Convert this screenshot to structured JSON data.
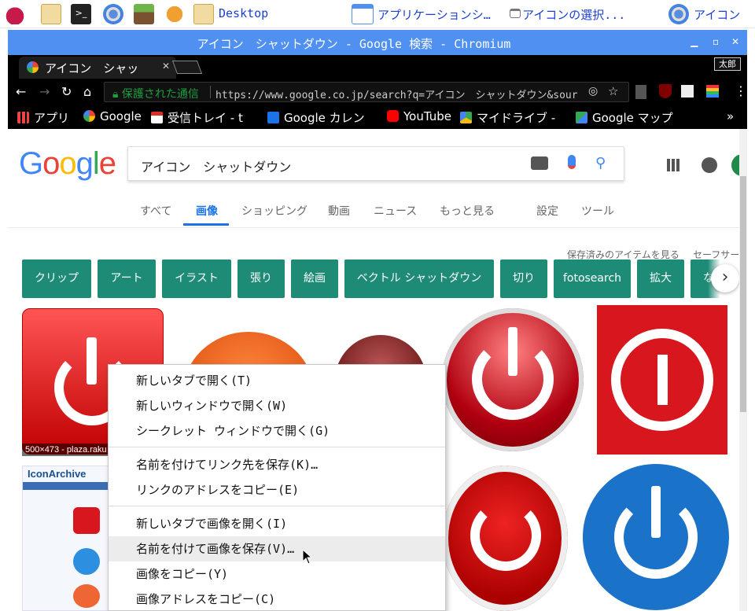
{
  "panel": {
    "desktop_label": "Desktop",
    "task1": "アプリケーションシ…",
    "task2": "アイコンの選択...",
    "task3": "アイコン"
  },
  "window": {
    "title": "アイコン　シャットダウン - Google 検索 - Chromium",
    "tab_title": "アイコン　シャッ",
    "profile_name": "太郎"
  },
  "toolbar": {
    "secure_label": "保護された通信",
    "url": "https://www.google.co.jp/search?q=アイコン　シャットダウン&sourc…"
  },
  "bookmarks": {
    "apps": "アプリ",
    "google": "Google",
    "inbox": "受信トレイ - t",
    "calendar": "Google カレン",
    "youtube": "YouTube",
    "drive": "マイドライブ -",
    "maps": "Google マップ",
    "overflow": "»"
  },
  "search": {
    "query": "アイコン　シャットダウン",
    "tabs": [
      "すべて",
      "画像",
      "ショッピング",
      "動画",
      "ニュース",
      "もっと見る",
      "設定",
      "ツール"
    ],
    "saved_items": "保存済みのアイテムを見る",
    "safe_search": "セーフサー",
    "chips": [
      "クリップ",
      "アート",
      "イラスト",
      "張り",
      "絵画",
      "ベクトル シャットダウン",
      "切り",
      "fotosearch",
      "拡大",
      "ない"
    ]
  },
  "results": {
    "first_caption": "500×473 - plaza.raku",
    "archive_title": "IconArchive"
  },
  "context_menu": {
    "items": [
      "新しいタブで開く(T)",
      "新しいウィンドウで開く(W)",
      "シークレット ウィンドウで開く(G)",
      "名前を付けてリンク先を保存(K)…",
      "リンクのアドレスをコピー(E)",
      "新しいタブで画像を開く(I)",
      "名前を付けて画像を保存(V)…",
      "画像をコピー(Y)",
      "画像アドレスをコピー(C)"
    ]
  },
  "colors": {
    "title_bar": "#4f90f0",
    "chip": "#1e8b77",
    "link_blue": "#1a73e8",
    "power_red": "#d7161e",
    "power_blue": "#1a73c8"
  }
}
